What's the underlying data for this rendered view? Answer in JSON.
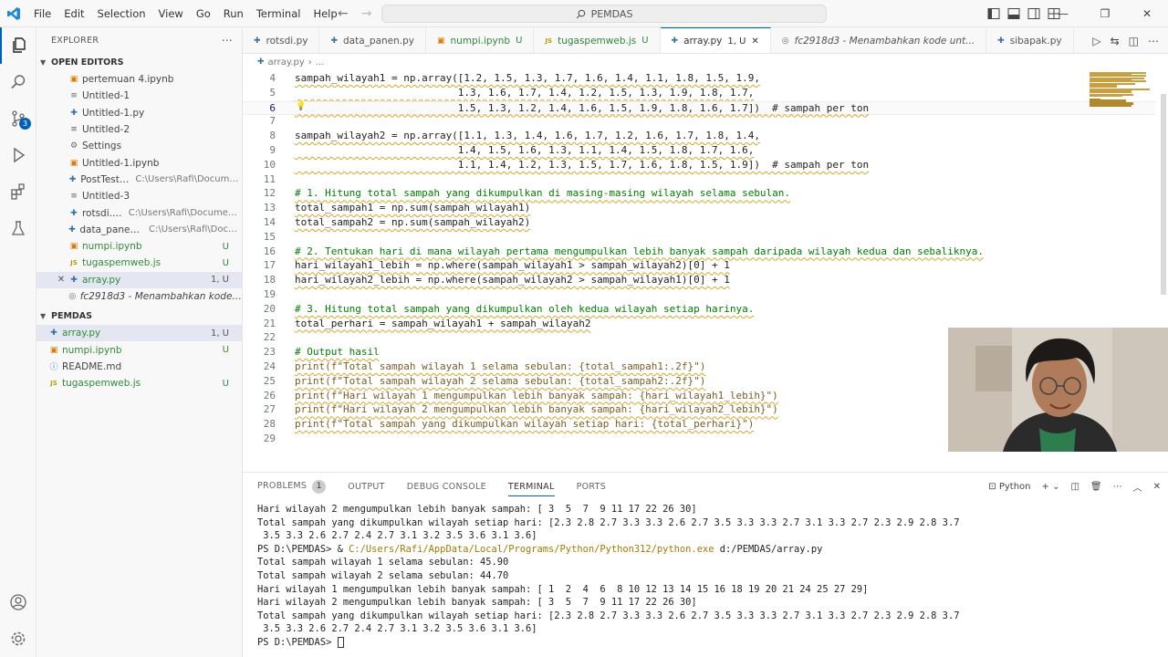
{
  "titlebar": {
    "menu": [
      "File",
      "Edit",
      "Selection",
      "View",
      "Go",
      "Run",
      "Terminal",
      "Help"
    ],
    "search_text": "PEMDAS"
  },
  "sidebar": {
    "title": "EXPLORER",
    "open_editors_label": "OPEN EDITORS",
    "open_editors": [
      {
        "icon": "notebook-icon",
        "name": "pertemuan 4.ipynb",
        "path": "",
        "status": ""
      },
      {
        "icon": "file-icon",
        "name": "Untitled-1",
        "path": "",
        "status": ""
      },
      {
        "icon": "python-file-icon",
        "name": "Untitled-1.py",
        "path": "",
        "status": ""
      },
      {
        "icon": "file-icon",
        "name": "Untitled-2",
        "path": "",
        "status": ""
      },
      {
        "icon": "settings-icon",
        "name": "Settings",
        "path": "",
        "status": ""
      },
      {
        "icon": "notebook-icon",
        "name": "Untitled-1.ipynb",
        "path": "",
        "status": ""
      },
      {
        "icon": "python-file-icon",
        "name": "PostTest.py",
        "path": "C:\\Users\\Rafi\\Documents",
        "status": ""
      },
      {
        "icon": "file-icon",
        "name": "Untitled-3",
        "path": "",
        "status": ""
      },
      {
        "icon": "python-file-icon",
        "name": "rotsdi.py",
        "path": "C:\\Users\\Rafi\\Documents",
        "status": ""
      },
      {
        "icon": "python-file-icon",
        "name": "data_panen.py",
        "path": "C:\\Users\\Rafi\\Docum...",
        "status": ""
      },
      {
        "icon": "notebook-icon",
        "name": "numpi.ipynb",
        "path": "",
        "status": "U"
      },
      {
        "icon": "js-file-icon",
        "name": "tugaspemweb.js",
        "path": "",
        "status": "U"
      },
      {
        "icon": "python-file-icon",
        "name": "array.py",
        "path": "",
        "status": "1, U"
      },
      {
        "icon": "commit-icon",
        "name": "fc2918d3 - Menambahkan kode un...",
        "path": "",
        "status": ""
      }
    ],
    "project_label": "PEMDAS",
    "project_files": [
      {
        "icon": "python-file-icon",
        "name": "array.py",
        "status": "1, U"
      },
      {
        "icon": "notebook-icon",
        "name": "numpi.ipynb",
        "status": "U"
      },
      {
        "icon": "info-file-icon",
        "name": "README.md",
        "status": ""
      },
      {
        "icon": "js-file-icon",
        "name": "tugaspemweb.js",
        "status": "U"
      }
    ]
  },
  "tabs": [
    {
      "icon": "python-file-icon",
      "name": "rotsdi.py",
      "status": ""
    },
    {
      "icon": "python-file-icon",
      "name": "data_panen.py",
      "status": ""
    },
    {
      "icon": "notebook-icon",
      "name": "numpi.ipynb",
      "status": "U"
    },
    {
      "icon": "js-file-icon",
      "name": "tugaspemweb.js",
      "status": "U"
    },
    {
      "icon": "python-file-icon",
      "name": "array.py",
      "status": "1, U"
    },
    {
      "icon": "commit-icon",
      "name": "fc2918d3 - Menambahkan kode unt...",
      "status": ""
    },
    {
      "icon": "python-file-icon",
      "name": "sibapak.py",
      "status": ""
    }
  ],
  "breadcrumb": [
    "array.py",
    "..."
  ],
  "editor": {
    "lines": [
      {
        "n": "4",
        "text": "sampah_wilayah1 = np.array([1.2, 1.5, 1.3, 1.7, 1.6, 1.4, 1.1, 1.8, 1.5, 1.9,",
        "kind": "code"
      },
      {
        "n": "5",
        "text": "                           1.3, 1.6, 1.7, 1.4, 1.2, 1.5, 1.3, 1.9, 1.8, 1.7,",
        "kind": "code"
      },
      {
        "n": "6",
        "text": "                           1.5, 1.3, 1.2, 1.4, 1.6, 1.5, 1.9, 1.8, 1.6, 1.7])  # sampah per ton",
        "kind": "code"
      },
      {
        "n": "7",
        "text": "",
        "kind": "code"
      },
      {
        "n": "8",
        "text": "sampah_wilayah2 = np.array([1.1, 1.3, 1.4, 1.6, 1.7, 1.2, 1.6, 1.7, 1.8, 1.4,",
        "kind": "code"
      },
      {
        "n": "9",
        "text": "                           1.4, 1.5, 1.6, 1.3, 1.1, 1.4, 1.5, 1.8, 1.7, 1.6,",
        "kind": "code"
      },
      {
        "n": "10",
        "text": "                           1.1, 1.4, 1.2, 1.3, 1.5, 1.7, 1.6, 1.8, 1.5, 1.9])  # sampah per ton",
        "kind": "code"
      },
      {
        "n": "11",
        "text": "",
        "kind": "code"
      },
      {
        "n": "12",
        "text": "# 1. Hitung total sampah yang dikumpulkan di masing-masing wilayah selama sebulan.",
        "kind": "comment"
      },
      {
        "n": "13",
        "text": "total_sampah1 = np.sum(sampah_wilayah1)",
        "kind": "code"
      },
      {
        "n": "14",
        "text": "total_sampah2 = np.sum(sampah_wilayah2)",
        "kind": "code"
      },
      {
        "n": "15",
        "text": "",
        "kind": "code"
      },
      {
        "n": "16",
        "text": "# 2. Tentukan hari di mana wilayah pertama mengumpulkan lebih banyak sampah daripada wilayah kedua dan sebaliknya.",
        "kind": "comment"
      },
      {
        "n": "17",
        "text": "hari_wilayah1_lebih = np.where(sampah_wilayah1 > sampah_wilayah2)[0] + 1",
        "kind": "code"
      },
      {
        "n": "18",
        "text": "hari_wilayah2_lebih = np.where(sampah_wilayah2 > sampah_wilayah1)[0] + 1",
        "kind": "code"
      },
      {
        "n": "19",
        "text": "",
        "kind": "code"
      },
      {
        "n": "20",
        "text": "# 3. Hitung total sampah yang dikumpulkan oleh kedua wilayah setiap harinya.",
        "kind": "comment"
      },
      {
        "n": "21",
        "text": "total_perhari = sampah_wilayah1 + sampah_wilayah2",
        "kind": "code"
      },
      {
        "n": "22",
        "text": "",
        "kind": "code"
      },
      {
        "n": "23",
        "text": "# Output hasil",
        "kind": "comment"
      },
      {
        "n": "24",
        "text": "print(f\"Total sampah wilayah 1 selama sebulan: {total_sampah1:.2f}\")",
        "kind": "print"
      },
      {
        "n": "25",
        "text": "print(f\"Total sampah wilayah 2 selama sebulan: {total_sampah2:.2f}\")",
        "kind": "print"
      },
      {
        "n": "26",
        "text": "print(f\"Hari wilayah 1 mengumpulkan lebih banyak sampah: {hari_wilayah1_lebih}\")",
        "kind": "print"
      },
      {
        "n": "27",
        "text": "print(f\"Hari wilayah 2 mengumpulkan lebih banyak sampah: {hari_wilayah2_lebih}\")",
        "kind": "print"
      },
      {
        "n": "28",
        "text": "print(f\"Total sampah yang dikumpulkan wilayah setiap hari: {total_perhari}\")",
        "kind": "print"
      },
      {
        "n": "29",
        "text": "",
        "kind": "code"
      }
    ]
  },
  "panel": {
    "tabs": [
      "PROBLEMS",
      "OUTPUT",
      "DEBUG CONSOLE",
      "TERMINAL",
      "PORTS"
    ],
    "problems_count": "1",
    "terminal_profile": "Python",
    "terminal_lines": [
      "Hari wilayah 2 mengumpulkan lebih banyak sampah: [ 3  5  7  9 11 17 22 26 30]",
      "Total sampah yang dikumpulkan wilayah setiap hari: [2.3 2.8 2.7 3.3 3.3 2.6 2.7 3.5 3.3 3.3 2.7 3.1 3.3 2.7 2.3 2.9 2.8 3.7",
      " 3.5 3.3 2.6 2.7 2.4 2.7 3.1 3.2 3.5 3.6 3.1 3.6]",
      "PS D:\\PEMDAS> & C:/Users/Rafi/AppData/Local/Programs/Python/Python312/python.exe d:/PEMDAS/array.py",
      "Total sampah wilayah 1 selama sebulan: 45.90",
      "Total sampah wilayah 2 selama sebulan: 44.70",
      "Hari wilayah 1 mengumpulkan lebih banyak sampah: [ 1  2  4  6  8 10 12 13 14 15 16 18 19 20 21 24 25 27 29]",
      "Hari wilayah 2 mengumpulkan lebih banyak sampah: [ 3  5  7  9 11 17 22 26 30]",
      "Total sampah yang dikumpulkan wilayah setiap hari: [2.3 2.8 2.7 3.3 3.3 2.6 2.7 3.5 3.3 3.3 2.7 3.1 3.3 2.7 2.3 2.9 2.8 3.7",
      " 3.5 3.3 2.6 2.7 2.4 2.7 3.1 3.2 3.5 3.6 3.1 3.6]",
      "PS D:\\PEMDAS> "
    ],
    "exe_command_prefix": "PS D:\\PEMDAS> & ",
    "exe_command_path": "C:/Users/Rafi/AppData/Local/Programs/Python/Python312/python.exe",
    "exe_command_arg": " d:/PEMDAS/array.py"
  },
  "colors": {
    "accent": "#005fb8",
    "untracked": "#2f8a3a",
    "comment": "#008000",
    "warning_squiggle": "#d4a72c"
  }
}
